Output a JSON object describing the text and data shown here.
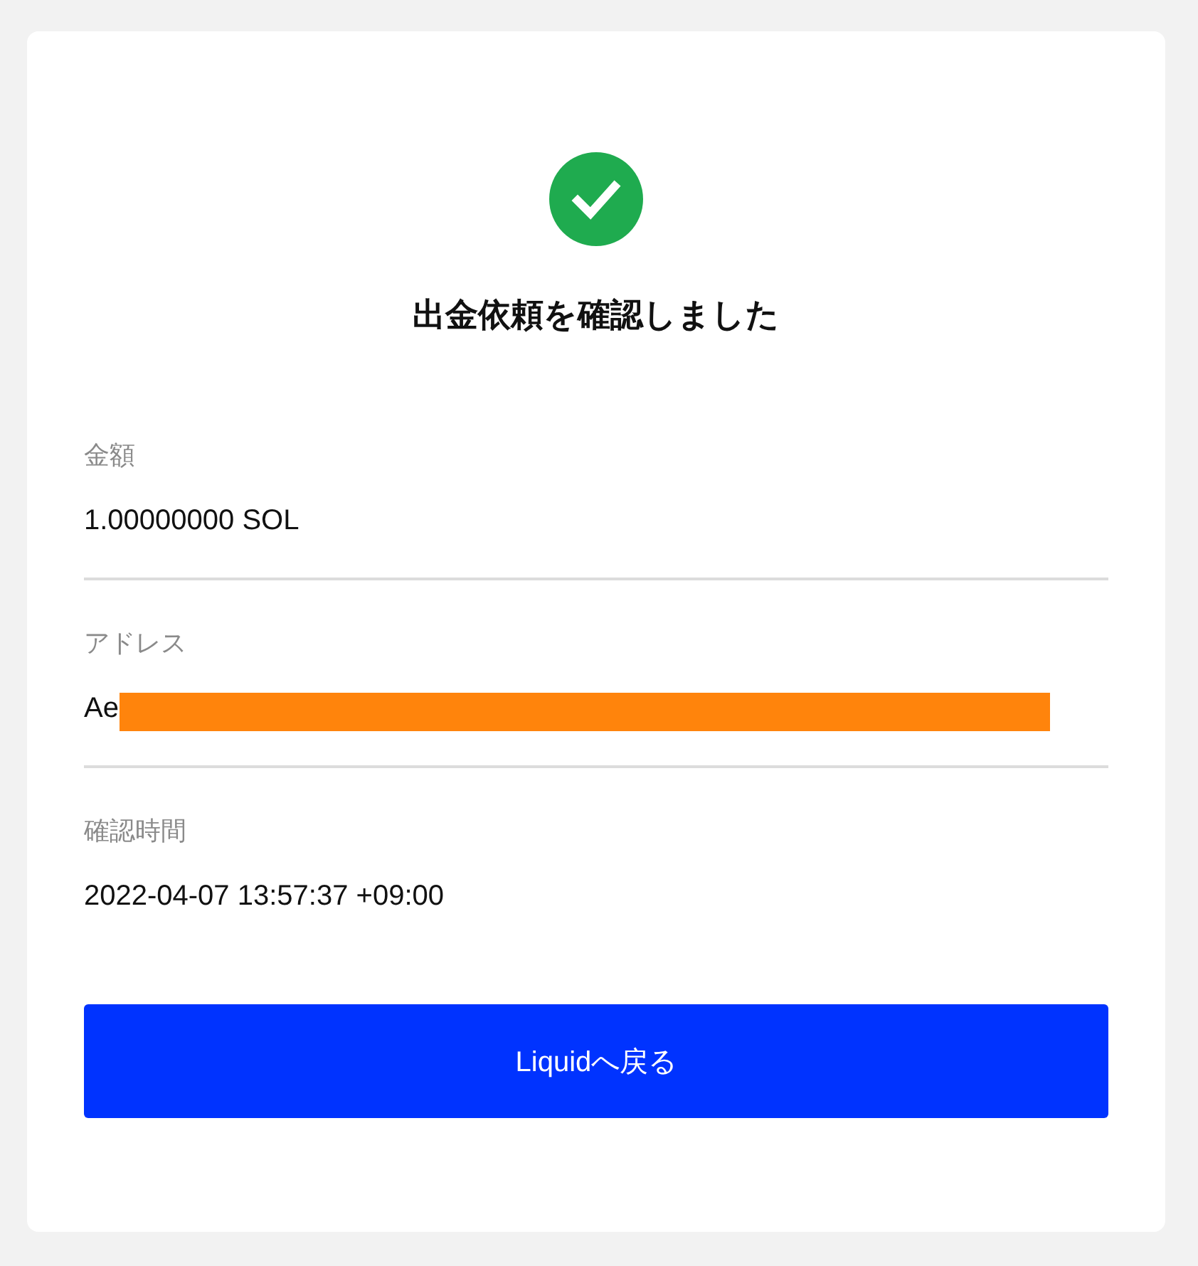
{
  "status": {
    "kind": "success",
    "title": "出金依頼を確認しました"
  },
  "fields": [
    {
      "label": "金額",
      "value": "1.00000000 SOL",
      "redacted": false
    },
    {
      "label": "アドレス",
      "value": "Ae",
      "redacted": true
    },
    {
      "label": "確認時間",
      "value": "2022-04-07 13:57:37 +09:00",
      "redacted": false
    }
  ],
  "button": {
    "label": "Liquidへ戻る"
  }
}
